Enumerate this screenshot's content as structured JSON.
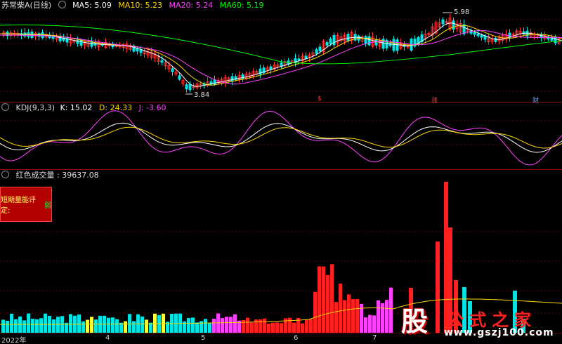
{
  "main_panel": {
    "title": "苏常柴A(日线)",
    "ma": [
      {
        "label": "MA5: 5.09",
        "color": "#ffffff"
      },
      {
        "label": "MA10: 5.23",
        "color": "#ffd700"
      },
      {
        "label": "MA20: 5.24",
        "color": "#ff40ff"
      },
      {
        "label": "MA60: 5.19",
        "color": "#00ff00"
      }
    ],
    "high_label": "5.98",
    "low_label": "3.84",
    "events": [
      {
        "text": "$",
        "color": "#ff4040"
      },
      {
        "text": "涨",
        "color": "#ff4040"
      },
      {
        "text": "财",
        "color": "#6aa0ff"
      }
    ]
  },
  "kdj_panel": {
    "title": "KDJ(9,3,3)",
    "k": "K: 15.02",
    "d": "D: 24.33",
    "j": "J: -3.60",
    "colors": {
      "k": "#ffffff",
      "d": "#ffd700",
      "j": "#ff40ff"
    }
  },
  "volume_panel": {
    "title": "红色成交量 : 39637.08",
    "warn_label": "短期量能评定:",
    "warn_value": "弱"
  },
  "x_axis": {
    "labels": [
      "2022年",
      "4",
      "5",
      "6",
      "7"
    ]
  },
  "watermark": {
    "icon_text": "股",
    "name": "公式之家",
    "url": "www.gszj100.com"
  }
}
